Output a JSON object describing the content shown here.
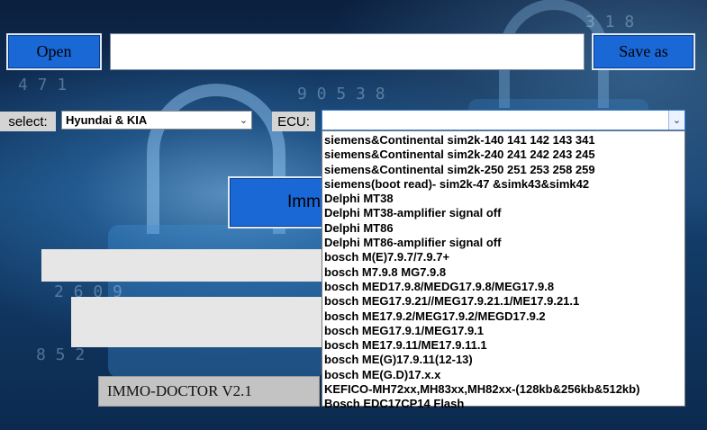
{
  "toolbar": {
    "open_label": "Open",
    "file_path_value": "",
    "save_label": "Save as"
  },
  "select_row": {
    "select_label": "select:",
    "brand_selected": "Hyundai & KIA",
    "ecu_label": "ECU:",
    "ecu_selected": ""
  },
  "main_button_partial": "Imm",
  "ecu_options": [
    "siemens&Continental sim2k-140 141 142 143 341",
    "siemens&Continental sim2k-240 241 242 243 245",
    "siemens&Continental sim2k-250 251 253 258 259",
    "siemens(boot read)- sim2k-47 &simk43&simk42",
    "Delphi MT38",
    "Delphi MT38-amplifier signal off",
    "Delphi MT86",
    "Delphi MT86-amplifier signal off",
    "bosch M(E)7.9.7/7.9.7+",
    "bosch M7.9.8 MG7.9.8",
    "bosch MED17.9.8/MEDG17.9.8/MEG17.9.8",
    "bosch MEG17.9.21//MEG17.9.21.1/ME17.9.21.1",
    "bosch ME17.9.2/MEG17.9.2/MEGD17.9.2",
    "bosch MEG17.9.1/MEG17.9.1",
    "bosch ME17.9.11/ME17.9.11.1",
    "bosch ME(G)17.9.11(12-13)",
    "bosch ME(G.D)17.x.x",
    "KEFICO-MH72xx,MH83xx,MH82xx-(128kb&256kb&512kb)",
    "Bosch EDC17CP14 Flash"
  ],
  "version_label": "IMMO-DOCTOR V2.1",
  "colors": {
    "button_blue": "#1a67d6",
    "panel_grey": "#e6e6e6",
    "label_grey": "#d4d4d4"
  }
}
